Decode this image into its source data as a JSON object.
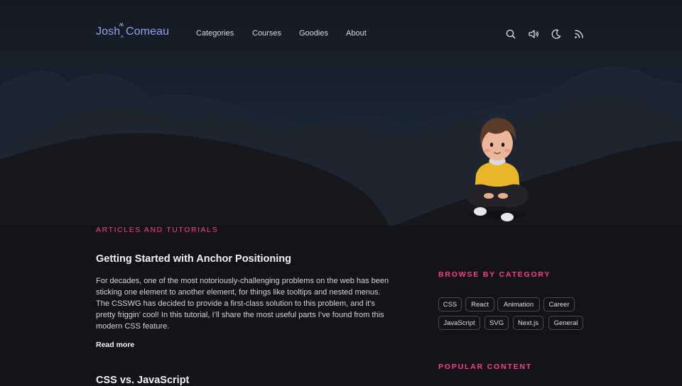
{
  "header": {
    "logo": {
      "first": "Josh",
      "last": "Comeau"
    },
    "nav": [
      "Categories",
      "Courses",
      "Goodies",
      "About"
    ],
    "icons": [
      "search-icon",
      "sound-icon",
      "dark-mode-icon",
      "rss-icon"
    ]
  },
  "colors": {
    "accent": "#ff3d8b",
    "logo": "#8fa0f5",
    "background": "#131418"
  },
  "main": {
    "section_label": "ARTICLES AND TUTORIALS",
    "articles": [
      {
        "title": "Getting Started with Anchor Positioning",
        "excerpt": "For decades, one of the most notoriously-challenging problems on the web has been sticking one element to another element, for things like tooltips and nested menus. The CSSWG has decided to provide a first-class solution to this problem, and it’s pretty friggin’ cool! In this tutorial, I’ll share the most useful parts I’ve found from this modern CSS feature.",
        "read_more": "Read more"
      },
      {
        "title": "CSS vs. JavaScript"
      }
    ]
  },
  "sidebar": {
    "browse_label": "BROWSE BY CATEGORY",
    "categories": [
      "CSS",
      "React",
      "Animation",
      "Career",
      "JavaScript",
      "SVG",
      "Next.js",
      "General"
    ],
    "popular_label": "POPULAR CONTENT"
  }
}
